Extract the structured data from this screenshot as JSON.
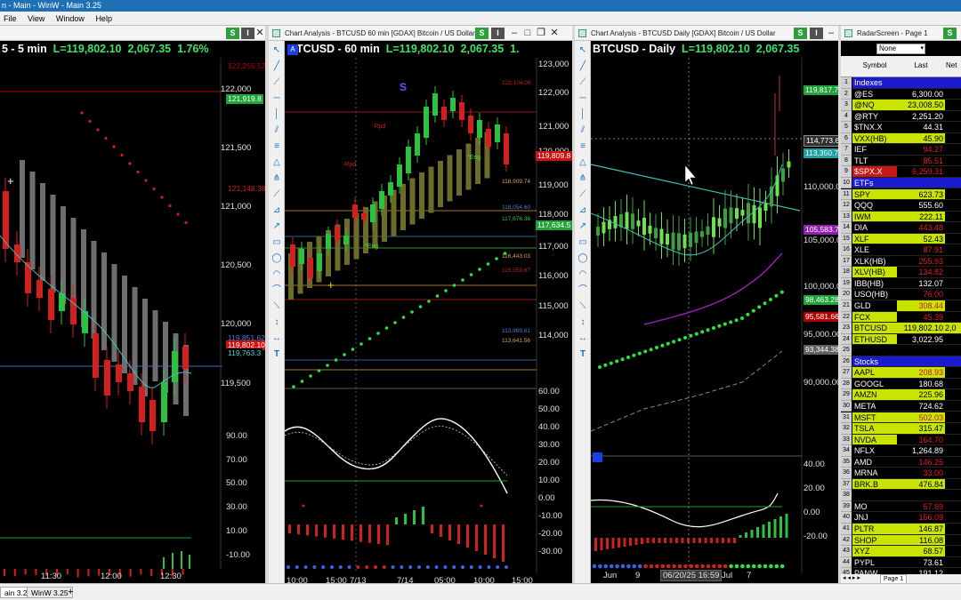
{
  "app": {
    "title": "n - Main - WinW - Main 3.25",
    "menu": [
      "File",
      "View",
      "Window",
      "Help"
    ]
  },
  "w1": {
    "title": "",
    "header": "5 - 5 min",
    "last": "L=119,802.10",
    "chg": "2,067.35",
    "pct": "1.76%",
    "yticks": [
      "122,000",
      "121,500",
      "121,000",
      "120,500",
      "120,000",
      "119,500"
    ],
    "tags": [
      {
        "t": "122,255.52",
        "c": "#b00000"
      },
      {
        "t": "121,919.8",
        "c": "#1fa33a"
      },
      {
        "t": "121,148.38",
        "c": "#b00000"
      },
      {
        "t": "119,851.62",
        "c": "#1f5fb3"
      },
      {
        "t": "119,802.10",
        "c": "#d01010"
      },
      {
        "t": "119,763.3",
        "c": "#1f9f9f"
      }
    ],
    "ind_ticks": [
      "90.00",
      "70.00",
      "50.00",
      "30.00",
      "10.00",
      "-10.00"
    ],
    "xticks": [
      "11:30",
      "12:00",
      "12:30"
    ]
  },
  "w2": {
    "title": "Chart Analysis - BTCUSD 60 min [GDAX] Bitcoin / US Dollar",
    "header": "BTCUSD - 60 min",
    "last": "L=119,802.10",
    "chg": "2,067.35",
    "pct": "1.",
    "yticks": [
      "123,000",
      "122,000",
      "121,000",
      "120,000",
      "119,000",
      "118,000",
      "117,000",
      "116,000",
      "115,000",
      "114,000"
    ],
    "tags": [
      {
        "t": "119,809.8",
        "c": "#d01010"
      },
      {
        "t": "117,634.5",
        "c": "#1fa33a"
      }
    ],
    "levels": [
      {
        "t": "122,104.09",
        "c": "#c02020"
      },
      {
        "t": "118,909.74",
        "c": "#e0a040"
      },
      {
        "t": "118,054.60",
        "c": "#4080d0"
      },
      {
        "t": "117,676.36",
        "c": "#40c040"
      },
      {
        "t": "116,443.03",
        "c": "#e0a040"
      },
      {
        "t": "115,559.67",
        "c": "#c02020"
      },
      {
        "t": "113,989.61",
        "c": "#4080d0"
      },
      {
        "t": "113,641.56",
        "c": "#e0a040"
      }
    ],
    "labels": {
      "s": "S",
      "rpd": "-Rpd",
      "rpd2": "-Rpd",
      "eng1": "*Eng",
      "eng2": "*Eng"
    },
    "ind_ticks": [
      "60.00",
      "50.00",
      "40.00",
      "30.00",
      "20.00",
      "10.00",
      "0.00",
      "-10.00",
      "-20.00",
      "-30.00"
    ],
    "xticks": [
      "10:00",
      "15:00",
      "7/13",
      "7/14",
      "05:00",
      "10:00",
      "15:00"
    ]
  },
  "w3": {
    "title": "Chart Analysis - BTCUSD Daily [GDAX] Bitcoin / US Dollar",
    "header": "BTCUSD - Daily",
    "last": "L=119,802.10",
    "chg": "2,067.35",
    "yticks": [
      "110,000.00",
      "105,000.00",
      "100,000.00",
      "95,000.00",
      "90,000.00"
    ],
    "tags": [
      {
        "t": "119,817.7",
        "c": "#1fa33a"
      },
      {
        "t": "114,773.6",
        "c": "#606060"
      },
      {
        "t": "113,350.7",
        "c": "#1f9f9f"
      },
      {
        "t": "105,583.7",
        "c": "#9020b0"
      },
      {
        "t": "98,463.28",
        "c": "#1fa33a"
      },
      {
        "t": "95,581.66",
        "c": "#b00000"
      },
      {
        "t": "93,344.38",
        "c": "#606060"
      }
    ],
    "ind_ticks": [
      "40.00",
      "20.00",
      "0.00",
      "-20.00"
    ],
    "xticks": [
      "Jun",
      "9",
      "06/20/25 16:59",
      "Jul",
      "7"
    ]
  },
  "radar": {
    "title": "RadarScreen - Page 1",
    "dropdown": "None",
    "cols": [
      "Symbol",
      "Last",
      "Net"
    ],
    "rows": [
      {
        "n": "1",
        "s": "Indexes",
        "l": "",
        "group": true
      },
      {
        "n": "2",
        "s": "@ES",
        "l": "6,300.00",
        "sb": "#000",
        "lb": "#000",
        "lc": "#fff"
      },
      {
        "n": "3",
        "s": "@NQ",
        "l": "23,008.50",
        "sb": "#c8e400",
        "sc": "#000",
        "lb": "#c8e400",
        "lc": "#000"
      },
      {
        "n": "4",
        "s": "@RTY",
        "l": "2,251.20",
        "lc": "#fff"
      },
      {
        "n": "5",
        "s": "$TNX.X",
        "l": "44.31",
        "lc": "#fff"
      },
      {
        "n": "6",
        "s": "VXX(HB)",
        "l": "45.90",
        "sb": "#c8e400",
        "sc": "#000",
        "lb": "#c8e400",
        "lc": "#000"
      },
      {
        "n": "7",
        "s": "IEF",
        "l": "94.27",
        "lc": "#e02020"
      },
      {
        "n": "8",
        "s": "TLT",
        "l": "85.51",
        "lc": "#e02020"
      },
      {
        "n": "9",
        "s": "$SPX.X",
        "l": "6,259.31",
        "sb": "#c81818",
        "lc": "#e02020"
      },
      {
        "n": "10",
        "s": "ETFs",
        "l": "",
        "group": true
      },
      {
        "n": "11",
        "s": "SPY",
        "l": "623.73",
        "sb": "#c8e400",
        "sc": "#000",
        "lb": "#c8e400",
        "lc": "#000"
      },
      {
        "n": "12",
        "s": "QQQ",
        "l": "555.60",
        "lc": "#fff"
      },
      {
        "n": "13",
        "s": "IWM",
        "l": "222.11",
        "sb": "#c8e400",
        "sc": "#000",
        "lb": "#c8e400",
        "lc": "#000"
      },
      {
        "n": "14",
        "s": "DIA",
        "l": "443.48",
        "lc": "#e02020"
      },
      {
        "n": "15",
        "s": "XLF",
        "l": "52.43",
        "sb": "#c8e400",
        "sc": "#000",
        "lb": "#c8e400",
        "lc": "#000"
      },
      {
        "n": "16",
        "s": "XLE",
        "l": "87.91",
        "lc": "#e02020"
      },
      {
        "n": "17",
        "s": "XLK(HB)",
        "l": "255.93",
        "lc": "#e02020"
      },
      {
        "n": "18",
        "s": "XLV(HB)",
        "l": "134.82",
        "sb": "#c8e400",
        "sc": "#000",
        "lc": "#e02020"
      },
      {
        "n": "19",
        "s": "IBB(HB)",
        "l": "132.07",
        "lc": "#fff"
      },
      {
        "n": "20",
        "s": "USO(HB)",
        "l": "76.00",
        "lc": "#e02020"
      },
      {
        "n": "21",
        "s": "GLD",
        "l": "308.44",
        "sb": "#000",
        "lb": "#c8e400",
        "lc": "#c81818"
      },
      {
        "n": "22",
        "s": "FCX",
        "l": "45.39",
        "sb": "#c8e400",
        "sc": "#000",
        "lc": "#e02020"
      },
      {
        "n": "23",
        "s": "BTCUSD",
        "l": "119,802.10",
        "sb": "#c8e400",
        "sc": "#000",
        "lb": "#c8e400",
        "lc": "#000"
      },
      {
        "n": "24",
        "s": "ETHUSD",
        "l": "3,022.95",
        "sb": "#c8e400",
        "sc": "#000",
        "lc": "#fff"
      },
      {
        "n": "25",
        "s": "",
        "l": ""
      },
      {
        "n": "26",
        "s": "Stocks",
        "l": "",
        "group": true
      },
      {
        "n": "27",
        "s": "AAPL",
        "l": "208.93",
        "sb": "#c8e400",
        "sc": "#000",
        "lb": "#c8e400",
        "lc": "#c81818"
      },
      {
        "n": "28",
        "s": "GOOGL",
        "l": "180.68",
        "lc": "#fff"
      },
      {
        "n": "29",
        "s": "AMZN",
        "l": "225.96",
        "sb": "#c8e400",
        "sc": "#000",
        "lb": "#c8e400",
        "lc": "#000"
      },
      {
        "n": "30",
        "s": "META",
        "l": "724.62",
        "lc": "#fff"
      },
      {
        "n": "31",
        "s": "MSFT",
        "l": "502.03",
        "sb": "#c8e400",
        "sc": "#000",
        "lb": "#c8e400",
        "lc": "#c81818"
      },
      {
        "n": "32",
        "s": "TSLA",
        "l": "315.47",
        "sb": "#c8e400",
        "sc": "#000",
        "lb": "#c8e400",
        "lc": "#000"
      },
      {
        "n": "33",
        "s": "NVDA",
        "l": "164.70",
        "sb": "#c8e400",
        "sc": "#000",
        "lc": "#e02020"
      },
      {
        "n": "34",
        "s": "NFLX",
        "l": "1,264.89",
        "lc": "#fff"
      },
      {
        "n": "35",
        "s": "AMD",
        "l": "146.25",
        "lc": "#e02020"
      },
      {
        "n": "36",
        "s": "MRNA",
        "l": "33.00",
        "lc": "#e02020"
      },
      {
        "n": "37",
        "s": "BRK.B",
        "l": "476.84",
        "sb": "#c8e400",
        "sc": "#000",
        "lb": "#c8e400",
        "lc": "#000"
      },
      {
        "n": "38",
        "s": "",
        "l": ""
      },
      {
        "n": "39",
        "s": "MO",
        "l": "57.69",
        "lc": "#e02020"
      },
      {
        "n": "40",
        "s": "JNJ",
        "l": "156.09",
        "lc": "#e02020"
      },
      {
        "n": "41",
        "s": "PLTR",
        "l": "146.87",
        "sb": "#c8e400",
        "sc": "#000",
        "lb": "#c8e400",
        "lc": "#000"
      },
      {
        "n": "42",
        "s": "SHOP",
        "l": "116.08",
        "sb": "#c8e400",
        "sc": "#000",
        "lb": "#c8e400",
        "lc": "#000"
      },
      {
        "n": "43",
        "s": "XYZ",
        "l": "68.57",
        "sb": "#c8e400",
        "sc": "#000",
        "lb": "#c8e400",
        "lc": "#000"
      },
      {
        "n": "44",
        "s": "PYPL",
        "l": "73.61",
        "lc": "#fff"
      },
      {
        "n": "45",
        "s": "PANW",
        "l": "191.12",
        "lc": "#fff"
      }
    ],
    "page_tab": "Page 1"
  },
  "taskbar": {
    "tabs": [
      "ain 3.25",
      "WinW 3.25"
    ],
    "add": "+"
  },
  "buttons": {
    "s": "S",
    "i": "I"
  }
}
